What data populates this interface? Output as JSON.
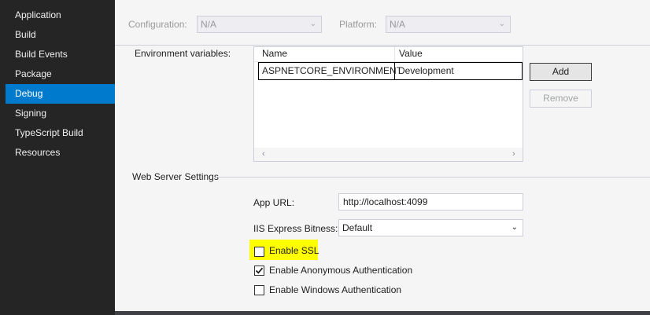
{
  "sidebar": {
    "items": [
      {
        "label": "Application"
      },
      {
        "label": "Build"
      },
      {
        "label": "Build Events"
      },
      {
        "label": "Package"
      },
      {
        "label": "Debug"
      },
      {
        "label": "Signing"
      },
      {
        "label": "TypeScript Build"
      },
      {
        "label": "Resources"
      }
    ],
    "active_index": 4
  },
  "toolbar": {
    "configuration_label": "Configuration:",
    "configuration_value": "N/A",
    "platform_label": "Platform:",
    "platform_value": "N/A"
  },
  "env": {
    "label": "Environment variables:",
    "columns": [
      "Name",
      "Value"
    ],
    "rows": [
      {
        "name": "ASPNETCORE_ENVIRONMENT",
        "value": "Development"
      }
    ],
    "add_label": "Add",
    "remove_label": "Remove"
  },
  "web": {
    "section_label": "Web Server Settings",
    "app_url_label": "App URL:",
    "app_url_value": "http://localhost:4099",
    "bitness_label": "IIS Express Bitness:",
    "bitness_value": "Default",
    "checkboxes": [
      {
        "label": "Enable SSL",
        "checked": false
      },
      {
        "label": "Enable Anonymous Authentication",
        "checked": true
      },
      {
        "label": "Enable Windows Authentication",
        "checked": false
      }
    ]
  },
  "colors": {
    "accent": "#007acc",
    "highlight": "#ffff00",
    "sidebar_bg": "#252526"
  }
}
